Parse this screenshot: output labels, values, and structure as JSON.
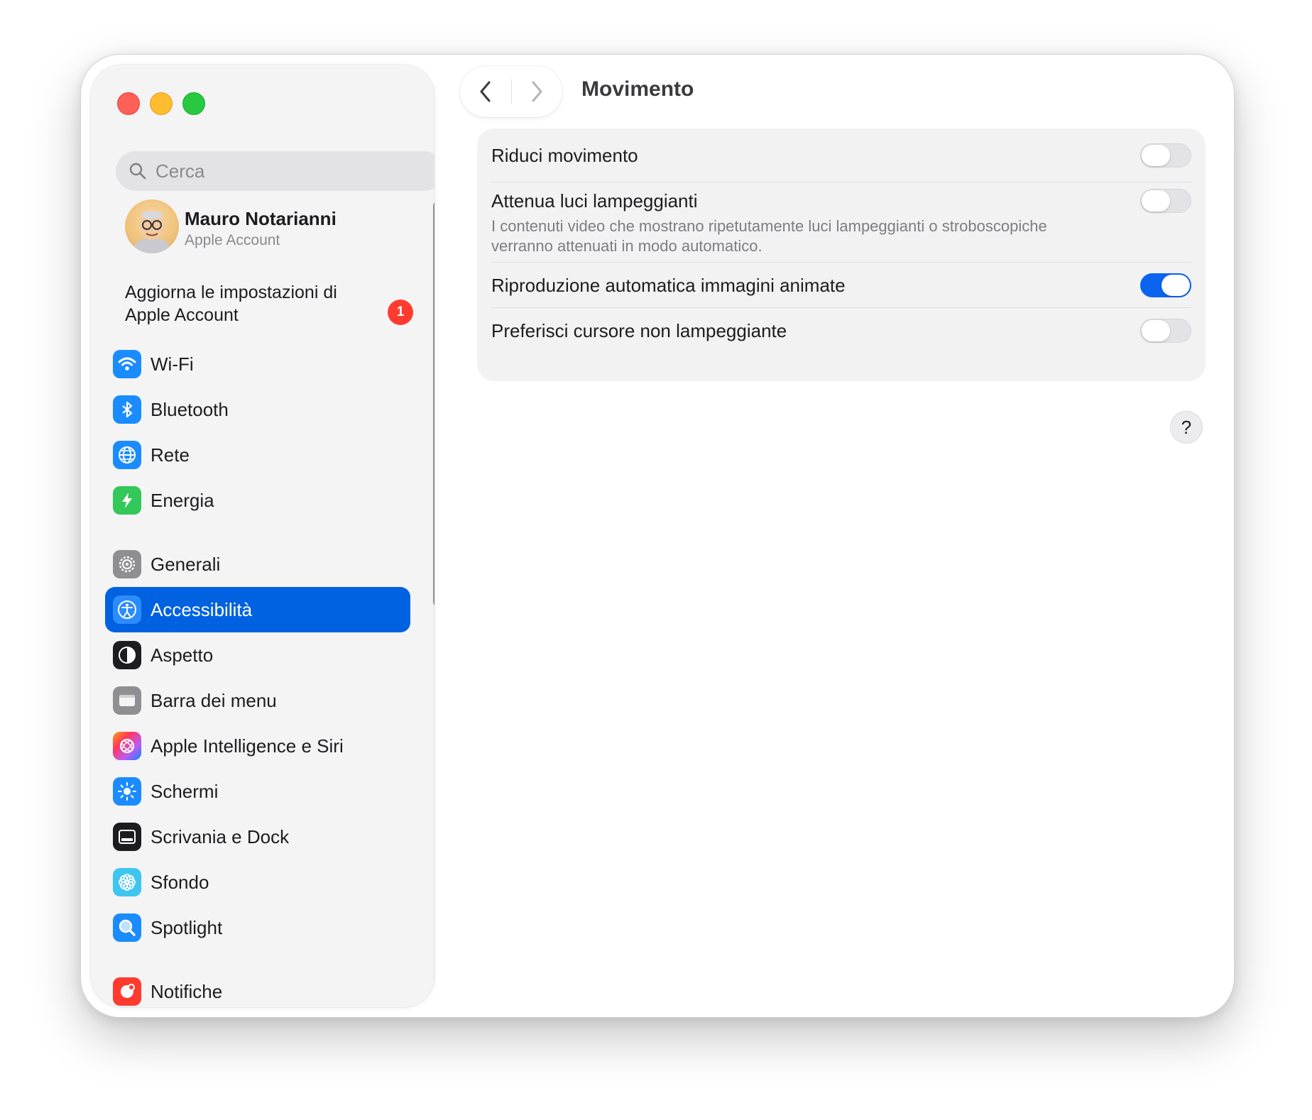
{
  "window": {
    "title": "Movimento"
  },
  "search": {
    "placeholder": "Cerca"
  },
  "profile": {
    "name": "Mauro Notarianni",
    "subtitle": "Apple Account"
  },
  "update": {
    "text": "Aggiorna le impostazioni di Apple Account",
    "badge": "1"
  },
  "sidebar": {
    "items": [
      {
        "label": "Wi-Fi",
        "icon": "wifi-icon",
        "color": "#1a8cff"
      },
      {
        "label": "Bluetooth",
        "icon": "bluetooth-icon",
        "color": "#1a8cff"
      },
      {
        "label": "Rete",
        "icon": "globe-icon",
        "color": "#1a8cff"
      },
      {
        "label": "Energia",
        "icon": "battery-bolt-icon",
        "color": "#34c759"
      },
      {
        "label": "Generali",
        "icon": "gear-icon",
        "color": "#8e8e93"
      },
      {
        "label": "Accessibilità",
        "icon": "accessibility-icon",
        "color": "#0a84ff",
        "selected": true
      },
      {
        "label": "Aspetto",
        "icon": "appearance-icon",
        "color": "#1d1d1f"
      },
      {
        "label": "Barra dei menu",
        "icon": "menubar-icon",
        "color": "#8e8e93"
      },
      {
        "label": "Apple Intelligence e Siri",
        "icon": "siri-icon",
        "color": "#ff7a59"
      },
      {
        "label": "Schermi",
        "icon": "sun-icon",
        "color": "#1a8cff"
      },
      {
        "label": "Scrivania e Dock",
        "icon": "dock-icon",
        "color": "#1d1d1f"
      },
      {
        "label": "Sfondo",
        "icon": "flower-icon",
        "color": "#3ec6f0"
      },
      {
        "label": "Spotlight",
        "icon": "magnifier-icon",
        "color": "#1a8cff"
      },
      {
        "label": "Notifiche",
        "icon": "bell-icon",
        "color": "#ff3b30"
      }
    ]
  },
  "settings": [
    {
      "title": "Riduci movimento",
      "description": "",
      "enabled": false
    },
    {
      "title": "Attenua luci lampeggianti",
      "description": "I contenuti video che mostrano ripetutamente luci lampeggianti o stroboscopiche verranno attenuati in modo automatico.",
      "enabled": false
    },
    {
      "title": "Riproduzione automatica immagini animate",
      "description": "",
      "enabled": true
    },
    {
      "title": "Preferisci cursore non lampeggiante",
      "description": "",
      "enabled": false
    }
  ],
  "help": {
    "label": "?"
  },
  "colors": {
    "accent": "#0062e1",
    "badge": "#ff3b30"
  }
}
